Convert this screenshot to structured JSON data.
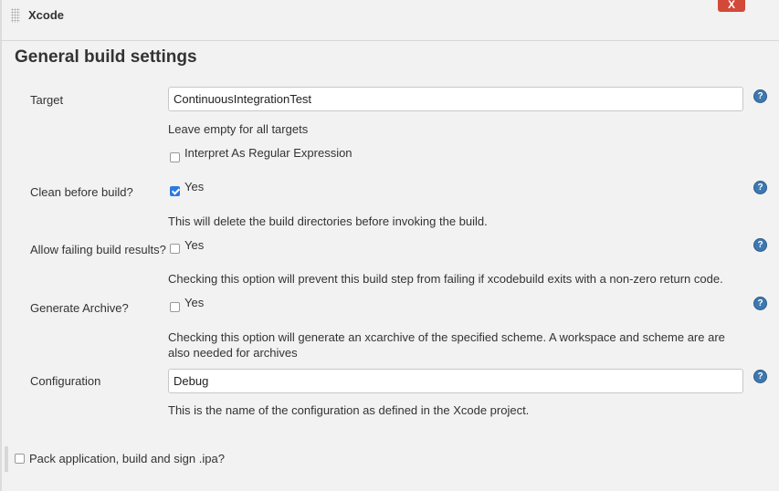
{
  "builder": {
    "title": "Xcode",
    "delete_label": "X"
  },
  "section": {
    "title": "General build settings"
  },
  "fields": {
    "target": {
      "label": "Target",
      "value": "ContinuousIntegrationTest",
      "description": "Leave empty for all targets",
      "regex_label": "Interpret As Regular Expression",
      "regex_checked": false
    },
    "clean": {
      "label": "Clean before build?",
      "option_label": "Yes",
      "checked": true,
      "description": "This will delete the build directories before invoking the build."
    },
    "allow_failing": {
      "label": "Allow failing build results?",
      "option_label": "Yes",
      "checked": false,
      "description": "Checking this option will prevent this build step from failing if xcodebuild exits with a non-zero return code."
    },
    "archive": {
      "label": "Generate Archive?",
      "option_label": "Yes",
      "checked": false,
      "description": "Checking this option will generate an xcarchive of the specified scheme. A workspace and scheme are are also needed for archives"
    },
    "configuration": {
      "label": "Configuration",
      "value": "Debug",
      "description": "This is the name of the configuration as defined in the Xcode project."
    }
  },
  "help_icon": "question-mark-icon",
  "help_glyph": "?",
  "pack": {
    "label": "Pack application, build and sign .ipa?",
    "checked": false
  },
  "colors": {
    "delete": "#d24939",
    "checkbox_checked": "#2a7ae2",
    "help": "#3f78b0"
  }
}
